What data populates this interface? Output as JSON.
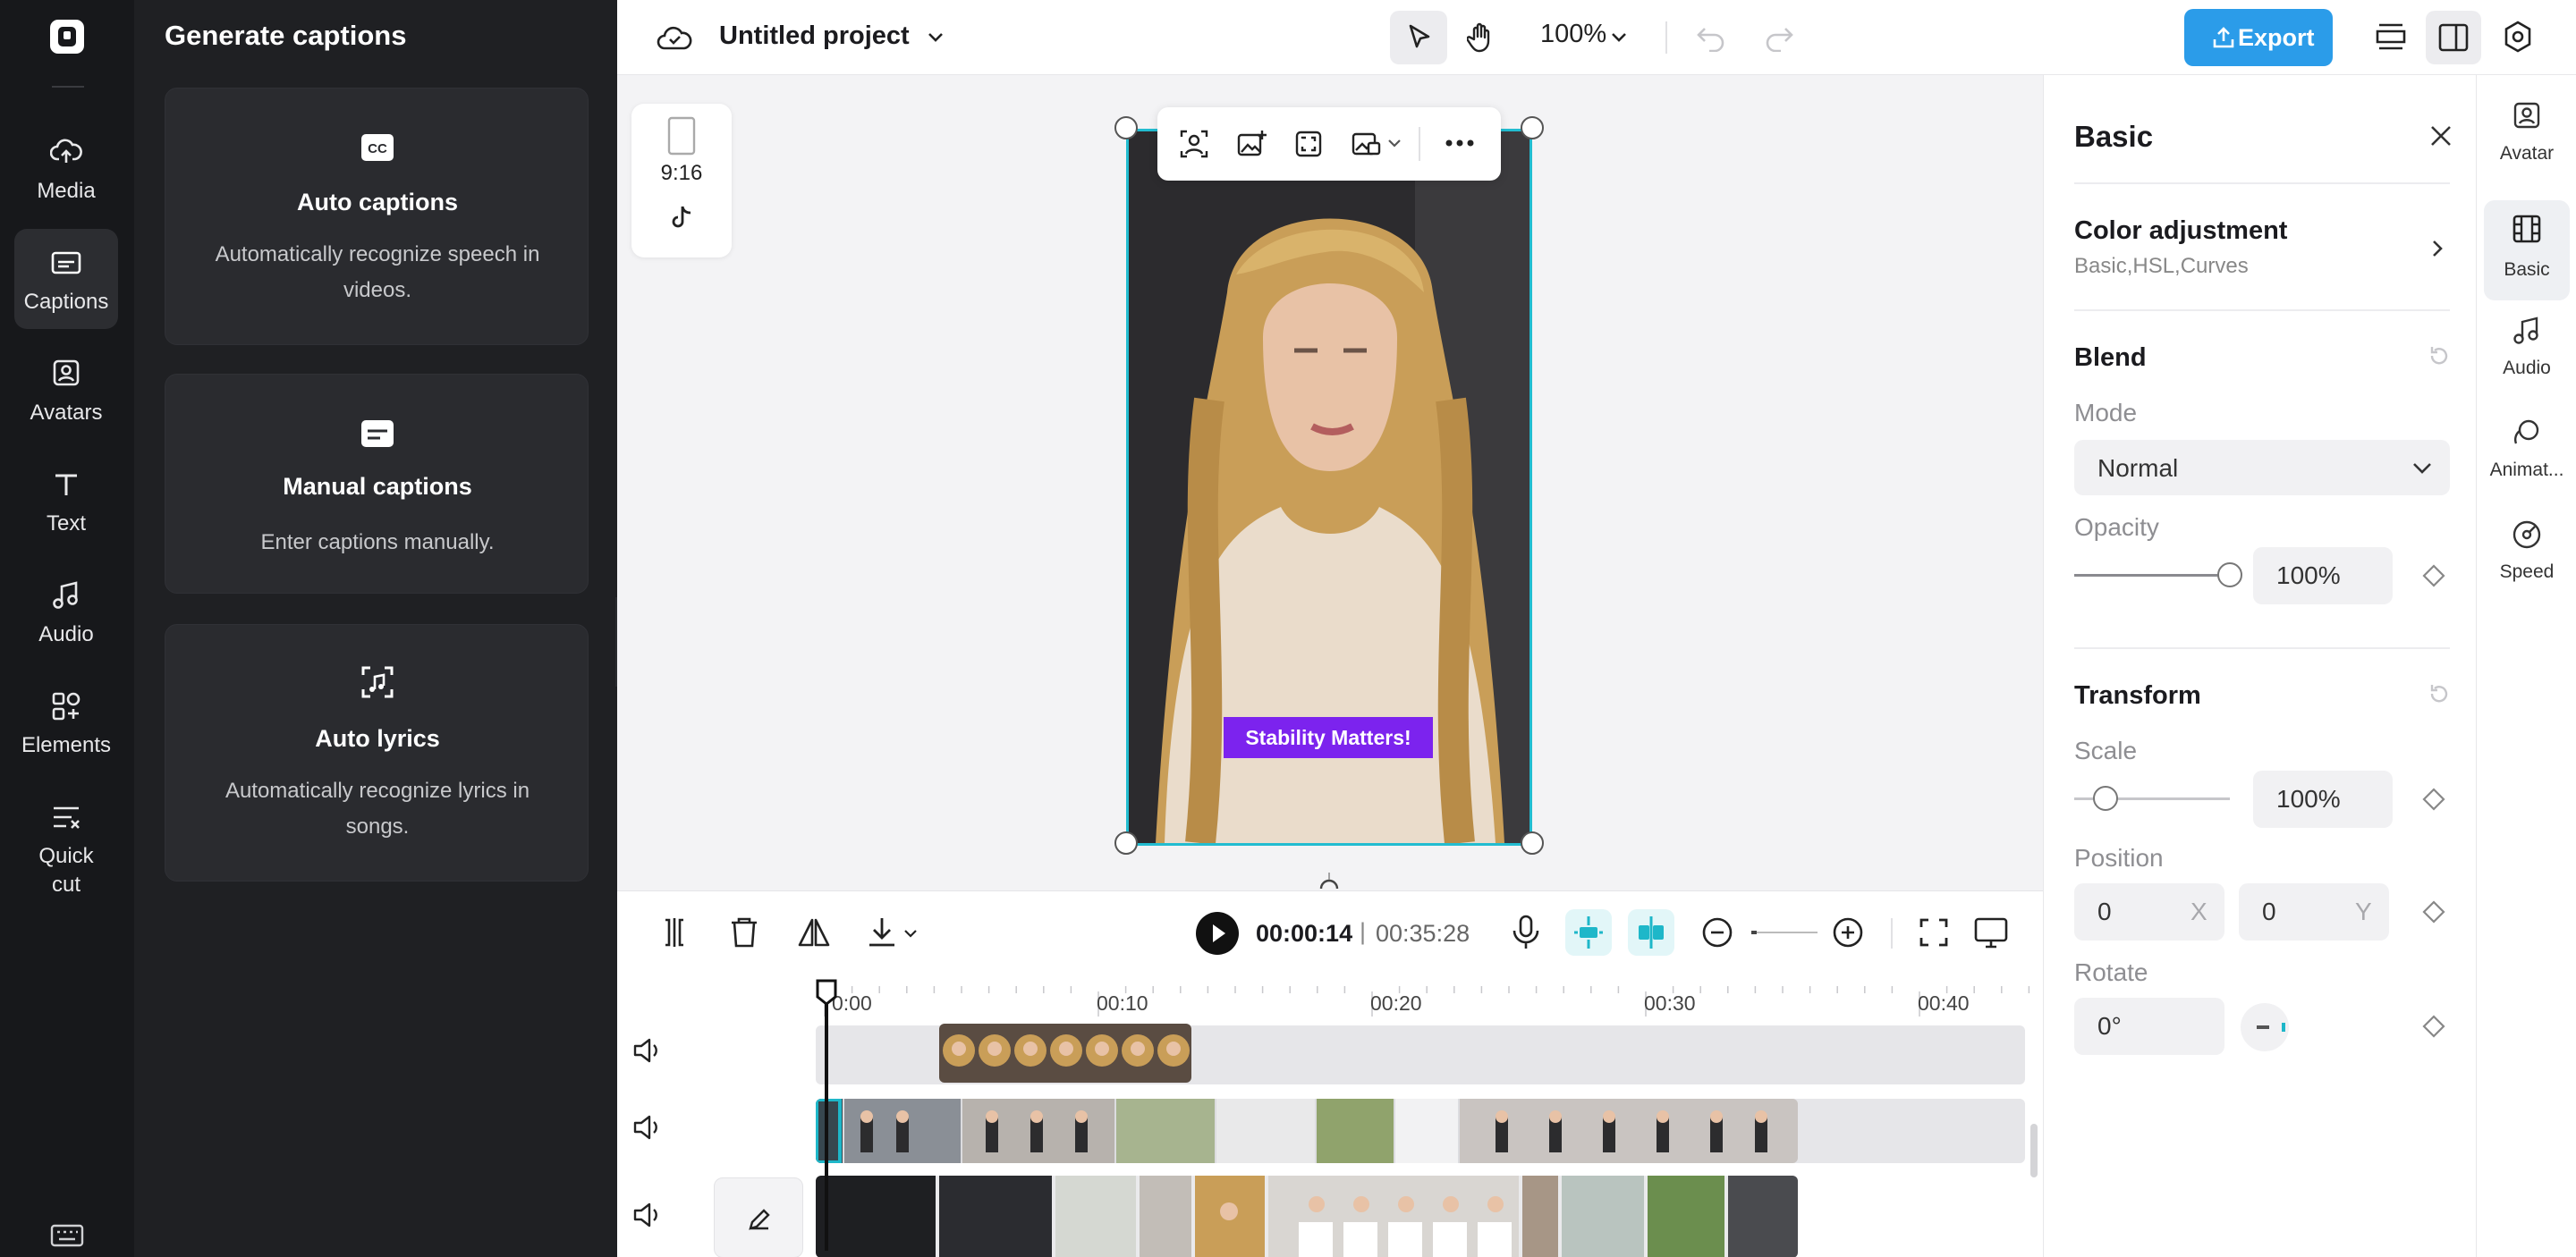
{
  "rail": {
    "items": [
      {
        "label": "Media",
        "icon": "cloud-upload-icon"
      },
      {
        "label": "Captions",
        "icon": "captions-icon"
      },
      {
        "label": "Avatars",
        "icon": "avatar-icon"
      },
      {
        "label": "Text",
        "icon": "text-icon"
      },
      {
        "label": "Audio",
        "icon": "music-note-icon"
      },
      {
        "label": "Elements",
        "icon": "elements-icon"
      },
      {
        "label": "Quick cut",
        "icon": "quick-cut-icon"
      }
    ],
    "active": "Captions"
  },
  "panel": {
    "title": "Generate captions",
    "cards": [
      {
        "title": "Auto captions",
        "desc": "Automatically recognize speech in videos.",
        "icon": "cc-icon"
      },
      {
        "title": "Manual captions",
        "desc": "Enter captions manually.",
        "icon": "subtitle-icon"
      },
      {
        "title": "Auto lyrics",
        "desc": "Automatically recognize lyrics in songs.",
        "icon": "lyrics-icon"
      }
    ]
  },
  "topbar": {
    "project_title": "Untitled project",
    "zoom": "100%",
    "export_label": "Export"
  },
  "canvas": {
    "aspect_ratio": "9:16",
    "caption_text": "Stability Matters!"
  },
  "timeline": {
    "current_time": "00:00:14",
    "separator": "|",
    "total_time": "00:35:28",
    "ticks": [
      "0:00",
      "00:10",
      "00:20",
      "00:30",
      "00:40"
    ]
  },
  "props": {
    "header": "Basic",
    "color_adjustment": {
      "title": "Color adjustment",
      "subtitle": "Basic,HSL,Curves"
    },
    "blend": {
      "title": "Blend",
      "mode_label": "Mode",
      "mode_value": "Normal",
      "opacity_label": "Opacity",
      "opacity_value": "100%",
      "opacity_level": 1.0
    },
    "transform": {
      "title": "Transform",
      "scale_label": "Scale",
      "scale_value": "100%",
      "scale_level": 0.2,
      "position_label": "Position",
      "pos_x": "0",
      "pos_x_axis": "X",
      "pos_y": "0",
      "pos_y_axis": "Y",
      "rotate_label": "Rotate",
      "rotate_value": "0°"
    }
  },
  "right_rail": {
    "items": [
      {
        "label": "Avatar",
        "icon": "avatar-icon"
      },
      {
        "label": "Basic",
        "icon": "film-icon"
      },
      {
        "label": "Audio",
        "icon": "music-note-icon"
      },
      {
        "label": "Animat...",
        "icon": "animation-icon"
      },
      {
        "label": "Speed",
        "icon": "speed-icon"
      }
    ],
    "active": "Basic"
  },
  "colors": {
    "accent": "#22bcd0",
    "export": "#2b9ce9",
    "caption_bg": "#7c23ee",
    "dark_rail": "#17181b"
  }
}
